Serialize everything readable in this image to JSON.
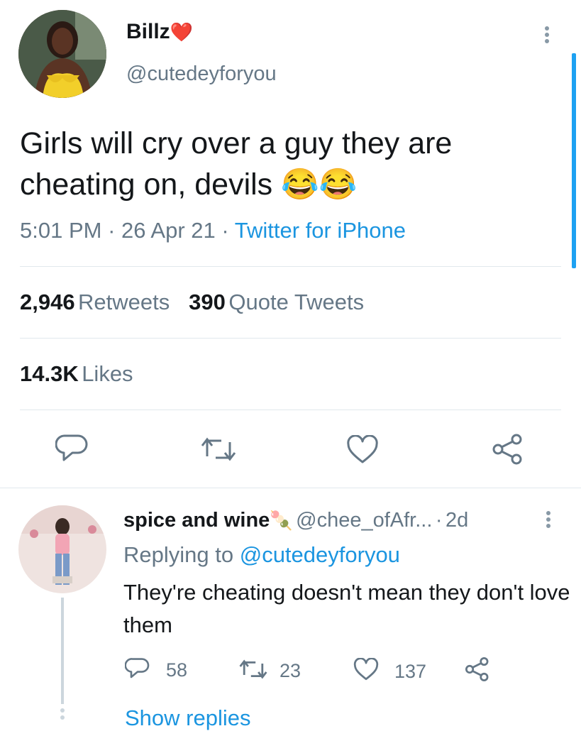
{
  "tweet": {
    "author_name": "Billz",
    "author_emoji": "❤️",
    "handle": "@cutedeyforyou",
    "text": "Girls will cry over a guy they are cheating on, devils 😂😂",
    "time": "5:01 PM",
    "date": "26 Apr 21",
    "source": "Twitter for iPhone",
    "retweets_count": "2,946",
    "retweets_label": "Retweets",
    "quotes_count": "390",
    "quotes_label": "Quote Tweets",
    "likes_count": "14.3K",
    "likes_label": "Likes"
  },
  "reply": {
    "author_name": "spice and wine",
    "author_emoji": "🍡",
    "handle": "@chee_ofAfr...",
    "age": "2d",
    "replying_prefix": "Replying to",
    "replying_handle": "@cutedeyforyou",
    "text": "They're cheating doesn't mean they don't love them",
    "reply_count": "58",
    "retweet_count": "23",
    "like_count": "137",
    "show_replies": "Show replies"
  },
  "colors": {
    "accent": "#1b95e0",
    "muted": "#657786",
    "text": "#14171a",
    "divider": "#e1e8ed"
  },
  "icons": [
    "more-vertical-icon",
    "reply-icon",
    "retweet-icon",
    "like-icon",
    "share-icon"
  ]
}
